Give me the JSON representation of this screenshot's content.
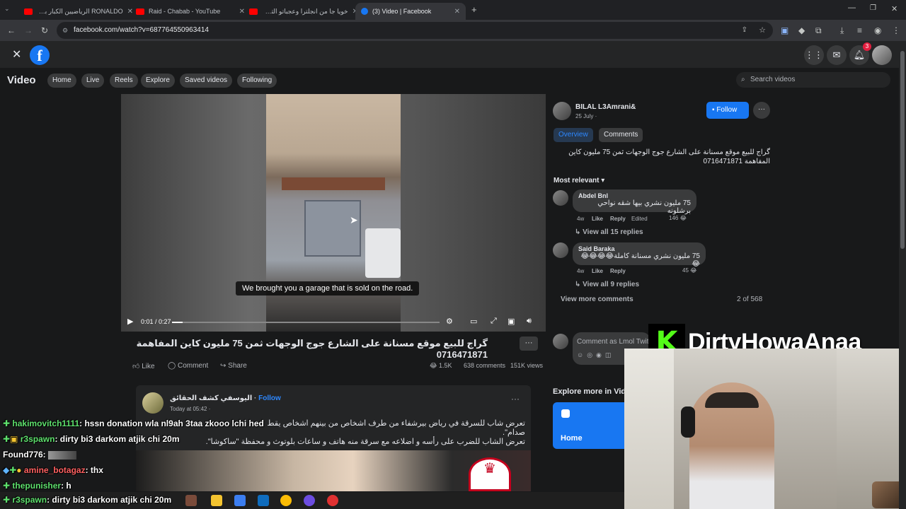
{
  "browser": {
    "tabs": [
      {
        "title": "RONALDO الرياضيين الكبار بخلال",
        "favicon_color": "#ff0000"
      },
      {
        "title": "Raid - Chabab - YouTube",
        "favicon_color": "#ff0000"
      },
      {
        "title": "خويا جا من انجلترا وعجباتو التحولة",
        "favicon_color": "#ff0000"
      },
      {
        "title": "(3) Video | Facebook",
        "favicon_color": "#1877f2"
      }
    ],
    "url": "facebook.com/watch?v=687764550963414"
  },
  "fb": {
    "notification_count": "3",
    "nav": {
      "title": "Video",
      "items": [
        "Home",
        "Live",
        "Reels",
        "Explore",
        "Saved videos",
        "Following"
      ],
      "search_placeholder": "Search videos"
    },
    "video": {
      "caption": "We brought you a garage that is sold on the road.",
      "time": "0:01 / 0:27",
      "progress_fraction": 0.04
    },
    "post": {
      "title": "گراج للبيع موقع مسنانة على الشارع جوج الوجهات ثمن 75 مليون كاين المفاهمة 0716471871",
      "like": "Like",
      "comment": "Comment",
      "share": "Share",
      "reactions": "1.5K",
      "comments_count": "638 comments",
      "views": "151K views"
    },
    "author": {
      "name": "BILAL L3Amrani&",
      "date": "25 July ·",
      "follow": "Follow"
    },
    "panel_tabs": [
      "Overview",
      "Comments"
    ],
    "description": "گراج للبيع موقع مسنانة على الشارع جوج الوجهات ثمن 75 مليون كاين المفاهمة 0716471871",
    "sort_label": "Most relevant",
    "comments": [
      {
        "name": "Abdel Bnl",
        "text": "75 مليون نشري بيها شقه نواحي برشلونه",
        "age": "4w",
        "like": "Like",
        "reply": "Reply",
        "edited": "Edited",
        "reactions": "146",
        "view_replies": "View all 15 replies"
      },
      {
        "name": "Said Baraka",
        "text": "75 مليون نشري مسنانة كاملة😂😂😂😂😂",
        "age": "4w",
        "like": "Like",
        "reply": "Reply",
        "reactions": "45",
        "view_replies": "View all 9 replies"
      }
    ],
    "view_more": "View more comments",
    "pager": "2 of 568",
    "comment_input_placeholder": "Comment as Lmol Twit",
    "explore_title": "Explore more in Vid",
    "explore_card_label": "Home",
    "post2": {
      "author": "اليوسفي كشف الحقائق",
      "follow": "Follow",
      "time": "Today at 05:42 ·",
      "text1": "تعرض شاب للسرقة في رياض بيرشفاء  من طرف اشخاص من بينهم اشخاص يقط",
      "text2": "صدام\".",
      "text3": "تعرض الشاب للضرب على رأسه و اضلاعه مع سرقة منه هاتف و ساعات بلوتوث و محفظة \"ساكوشا\"."
    }
  },
  "stream": {
    "logo_letter": "K",
    "name": "DirtyHowaAnaa",
    "accent": "#53fc18"
  },
  "chat": [
    {
      "user": "hakimovitch1111",
      "msg": ": hssn donation wla nl9ah 3taa zkooo lchi hed"
    },
    {
      "user": "r3spawn",
      "msg": ": dirty bi3 darkom atjik chi 20m"
    },
    {
      "user": "Found776",
      "msg": ":"
    },
    {
      "user": "amine_botagaz",
      "msg": ": thx"
    },
    {
      "user": "thepunisher",
      "msg": ": h"
    },
    {
      "user": "r3spawn",
      "msg": ": dirty bi3 darkom atjik chi 20m"
    }
  ]
}
